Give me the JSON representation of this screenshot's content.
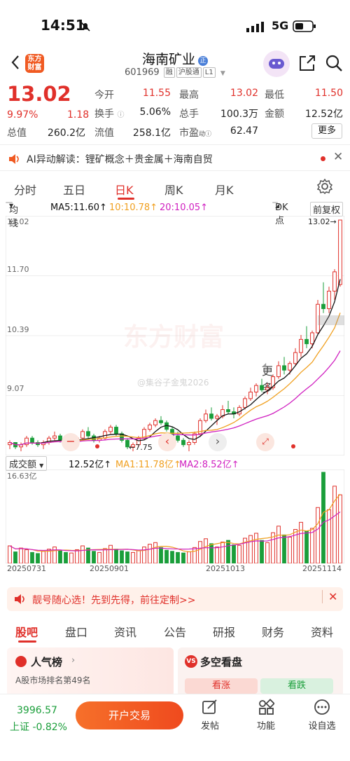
{
  "status_bar": {
    "time": "14:51",
    "network": "5G"
  },
  "header": {
    "logo_text": "东方财富",
    "title": "海南矿业",
    "code": "601969",
    "tags": [
      "融",
      "沪股通",
      "L1"
    ]
  },
  "quote": {
    "price": "13.02",
    "change_pct": "9.97%",
    "change": "1.18",
    "open_label": "今开",
    "open": "11.55",
    "high_label": "最高",
    "high": "13.02",
    "low_label": "最低",
    "low": "11.50",
    "turnover_label": "换手",
    "turnover": "5.06%",
    "volume_label": "总手",
    "volume": "100.3万",
    "amount_label": "金额",
    "amount": "12.52亿",
    "mktcap_label": "总值",
    "mktcap": "260.2亿",
    "float_label": "流值",
    "float": "258.1亿",
    "pe_label": "市盈",
    "pe": "62.47",
    "more_label": "更多"
  },
  "ai_bar": {
    "text": "AI异动解读：锂矿概念＋贵金属＋海南自贸"
  },
  "tabs": [
    "分时",
    "五日",
    "日K",
    "周K",
    "月K",
    "更多"
  ],
  "active_tab": "日K",
  "kline": {
    "type_label": "均线",
    "ma5": "MA5:11.60↑",
    "ma10": "10:10.78↑",
    "ma20": "20:10.05↑",
    "dk_label": "DK点",
    "adjust_label": "前复权",
    "price_ticks": [
      "13.02",
      "11.70",
      "10.39",
      "9.07"
    ],
    "max_marker": "13.02→",
    "min_marker": "←7.75",
    "watermark": "东方财富",
    "author": "@集谷子金鬼2026"
  },
  "volume": {
    "label": "成交额",
    "amount": "12.52亿↑",
    "ma1": "MA1:11.78亿↑",
    "ma2": "MA2:8.52亿↑",
    "max_tick": "16.63亿"
  },
  "dates": [
    "20250731",
    "20250901",
    "20251013",
    "20251114"
  ],
  "banner": {
    "text": "靓号随心选！先到先得，前往定制>>"
  },
  "bottom_tabs": [
    "股吧",
    "盘口",
    "资讯",
    "公告",
    "研报",
    "财务",
    "资料"
  ],
  "cards": {
    "popular_title": "人气榜",
    "popular_rank_text": "A股市场排名第49名",
    "bull_bear_title": "多空看盘",
    "bull": "看涨",
    "bear": "看跌"
  },
  "footer": {
    "index_value": "3996.57",
    "index_name": "上证",
    "index_change": "-0.82%",
    "trade_btn": "开户交易",
    "post": "发帖",
    "func": "功能",
    "self": "设自选"
  },
  "colors": {
    "up": "#e0302a",
    "down": "#1a9e3a",
    "ma5": "#111111",
    "ma10": "#f0a020",
    "ma20": "#d020c0",
    "accent": "#f05a22"
  },
  "chart_data": {
    "type": "candlestick",
    "ma_lines": [
      "MA5",
      "MA10",
      "MA20"
    ],
    "price_axis": [
      7.75,
      13.02
    ],
    "candles": [
      [
        7.9,
        8.0,
        7.8,
        7.95
      ],
      [
        7.95,
        7.95,
        7.8,
        7.85
      ],
      [
        7.85,
        7.95,
        7.75,
        7.9
      ],
      [
        7.9,
        8.1,
        7.85,
        8.05
      ],
      [
        8.05,
        8.1,
        7.9,
        7.95
      ],
      [
        7.95,
        8.0,
        7.85,
        7.9
      ],
      [
        7.9,
        8.0,
        7.8,
        7.95
      ],
      [
        7.95,
        8.1,
        7.9,
        8.05
      ],
      [
        8.05,
        8.2,
        8.0,
        8.1
      ],
      [
        8.1,
        8.15,
        7.95,
        8.0
      ],
      [
        8.0,
        8.05,
        7.85,
        7.9
      ],
      [
        7.9,
        8.0,
        7.8,
        7.95
      ],
      [
        7.95,
        8.1,
        7.9,
        8.05
      ],
      [
        8.05,
        8.25,
        8.0,
        8.2
      ],
      [
        8.2,
        8.3,
        8.05,
        8.1
      ],
      [
        8.1,
        8.15,
        7.95,
        8.0
      ],
      [
        8.0,
        8.1,
        7.95,
        8.05
      ],
      [
        8.05,
        8.25,
        8.0,
        8.2
      ],
      [
        8.2,
        8.35,
        8.15,
        8.3
      ],
      [
        8.3,
        8.35,
        8.1,
        8.15
      ],
      [
        8.15,
        8.2,
        7.95,
        8.0
      ],
      [
        8.0,
        8.05,
        7.8,
        7.85
      ],
      [
        7.85,
        7.95,
        7.75,
        7.9
      ],
      [
        7.9,
        8.1,
        7.85,
        8.05
      ],
      [
        8.05,
        8.3,
        8.0,
        8.25
      ],
      [
        8.25,
        8.4,
        8.2,
        8.35
      ],
      [
        8.35,
        8.5,
        8.3,
        8.45
      ],
      [
        8.45,
        8.55,
        8.35,
        8.4
      ],
      [
        8.4,
        8.45,
        8.2,
        8.25
      ],
      [
        8.25,
        8.3,
        8.05,
        8.1
      ],
      [
        8.1,
        8.2,
        7.95,
        8.0
      ],
      [
        8.0,
        8.05,
        7.85,
        7.9
      ],
      [
        7.9,
        8.0,
        7.75,
        7.95
      ],
      [
        7.95,
        8.2,
        7.9,
        8.15
      ],
      [
        8.15,
        8.5,
        8.1,
        8.45
      ],
      [
        8.45,
        8.7,
        8.4,
        8.6
      ],
      [
        8.6,
        8.75,
        8.45,
        8.5
      ],
      [
        8.5,
        8.6,
        8.35,
        8.55
      ],
      [
        8.55,
        8.8,
        8.5,
        8.7
      ],
      [
        8.7,
        8.9,
        8.6,
        8.65
      ],
      [
        8.65,
        8.75,
        8.5,
        8.6
      ],
      [
        8.6,
        8.8,
        8.55,
        8.75
      ],
      [
        8.75,
        9.0,
        8.7,
        8.95
      ],
      [
        8.95,
        9.2,
        8.9,
        9.1
      ],
      [
        9.1,
        9.3,
        9.0,
        9.25
      ],
      [
        9.25,
        9.4,
        9.1,
        9.15
      ],
      [
        9.15,
        9.3,
        9.05,
        9.2
      ],
      [
        9.2,
        9.5,
        9.15,
        9.45
      ],
      [
        9.45,
        9.8,
        9.4,
        9.7
      ],
      [
        9.7,
        9.9,
        9.5,
        9.6
      ],
      [
        9.6,
        9.8,
        9.5,
        9.75
      ],
      [
        9.75,
        10.1,
        9.7,
        10.0
      ],
      [
        10.0,
        10.4,
        9.9,
        10.3
      ],
      [
        10.3,
        10.6,
        10.1,
        10.2
      ],
      [
        10.2,
        10.5,
        10.1,
        10.45
      ],
      [
        10.45,
        11.2,
        10.4,
        11.1
      ],
      [
        11.1,
        11.6,
        10.9,
        11.0
      ],
      [
        11.0,
        11.5,
        10.9,
        11.4
      ],
      [
        11.4,
        11.9,
        11.2,
        11.84
      ],
      [
        11.55,
        13.02,
        11.5,
        13.02
      ]
    ],
    "volumes": [
      3.2,
      2.1,
      2.8,
      2.5,
      2.0,
      1.8,
      2.2,
      2.6,
      3.0,
      2.4,
      2.0,
      1.9,
      2.5,
      3.2,
      2.8,
      2.2,
      2.0,
      2.7,
      3.3,
      2.6,
      2.3,
      2.1,
      2.0,
      2.4,
      3.0,
      3.5,
      3.8,
      2.9,
      2.4,
      2.2,
      2.0,
      1.9,
      2.1,
      2.9,
      4.0,
      4.5,
      3.6,
      3.0,
      3.9,
      4.2,
      3.4,
      3.3,
      4.6,
      5.1,
      5.5,
      4.2,
      3.8,
      5.6,
      6.8,
      5.2,
      4.8,
      6.2,
      7.5,
      5.9,
      6.4,
      10.2,
      16.63,
      9.8,
      14.1,
      12.52
    ]
  }
}
